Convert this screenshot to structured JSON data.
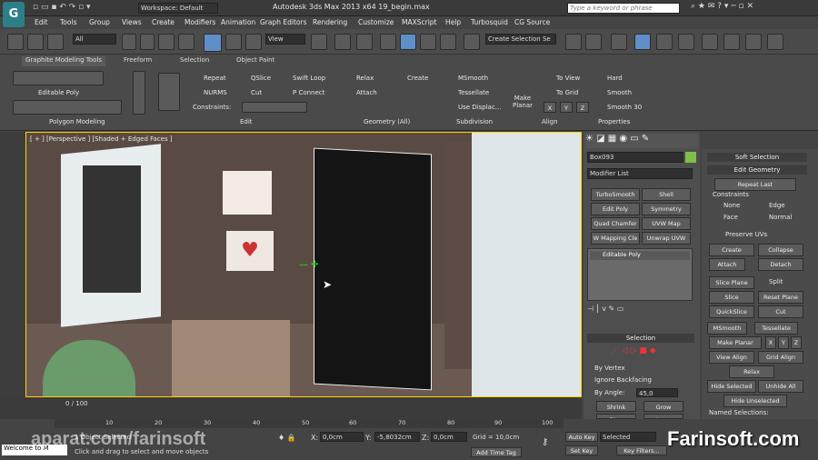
{
  "window": {
    "title": "Autodesk 3ds Max  2013 x64     19_begin.max",
    "workspace": "Workspace: Default",
    "search_placeholder": "Type a keyword or phrase"
  },
  "menu": [
    "Edit",
    "Tools",
    "Group",
    "Views",
    "Create",
    "Modifiers",
    "Animation",
    "Graph Editors",
    "Rendering",
    "Customize",
    "MAXScript",
    "Help",
    "Turbosquid",
    "CG Source"
  ],
  "toolbar": {
    "filter": "All",
    "view": "View",
    "selection_set": "Create Selection Se"
  },
  "ribbon": {
    "tabs": [
      "Graphite Modeling Tools",
      "Freeform",
      "Selection",
      "Object Paint"
    ],
    "editable_poly": "Editable Poly",
    "polygon_modeling": "Polygon Modeling",
    "repeat": "Repeat",
    "qslice": "QSlice",
    "swift_loop": "Swift Loop",
    "nurms": "NURMS",
    "cut": "Cut",
    "p_connect": "P Connect",
    "constraints": "Constraints:",
    "edit": "Edit",
    "relax": "Relax",
    "create": "Create",
    "attach": "Attach",
    "geometry_all": "Geometry (All)",
    "msmooth": "MSmooth",
    "tessellate": "Tessellate",
    "use_displac": "Use Displac...",
    "subdivision": "Subdivision",
    "make_planar": "Make Planar",
    "to_view": "To View",
    "to_grid": "To Grid",
    "x": "X",
    "y": "Y",
    "z": "Z",
    "align": "Align",
    "hard": "Hard",
    "smooth": "Smooth",
    "smooth30": "Smooth 30",
    "properties": "Properties"
  },
  "viewport": {
    "label": "[ + ] [Perspective ] [Shaded + Edged Faces ]"
  },
  "command_panel": {
    "object_name": "Box093",
    "modifier_list": "Modifier List",
    "buttons": [
      "TurboSmooth",
      "Shell",
      "Edit Poly",
      "Symmetry",
      "Quad Chamfer",
      "UVW Map",
      "W Mapping Cle",
      "Unwrap UVW"
    ],
    "stack_item": "Editable Poly",
    "selection": "Selection",
    "by_vertex": "By Vertex",
    "ignore_backfacing": "Ignore Backfacing",
    "by_angle": "By Angle:",
    "angle_value": "45,0",
    "shrink": "Shrink",
    "grow": "Grow",
    "ring": "Ring",
    "loop": "Loop"
  },
  "graphite_panel": {
    "soft_selection": "Soft Selection",
    "edit_geometry": "Edit Geometry",
    "repeat_last": "Repeat Last",
    "constraints": "Constraints",
    "none": "None",
    "edge": "Edge",
    "face": "Face",
    "normal": "Normal",
    "preserve_uvs": "Preserve UVs",
    "create": "Create",
    "collapse": "Collapse",
    "attach": "Attach",
    "detach": "Detach",
    "slice_plane": "Slice Plane",
    "split": "Split",
    "slice": "Slice",
    "reset_plane": "Reset Plane",
    "quickslice": "QuickSlice",
    "cut": "Cut",
    "msmooth": "MSmooth",
    "tessellate": "Tessellate",
    "make_planar": "Make Planar",
    "x": "X",
    "y": "Y",
    "z": "Z",
    "view_align": "View Align",
    "grid_align": "Grid Align",
    "relax": "Relax",
    "hide_selected": "Hide Selected",
    "unhide_all": "Unhide All",
    "hide_unselected": "Hide Unselected",
    "named_selections": "Named Selections:"
  },
  "timeline": {
    "frame": "0 / 100",
    "ticks": [
      "10",
      "20",
      "30",
      "40",
      "50",
      "60",
      "70",
      "80",
      "90",
      "100"
    ]
  },
  "status": {
    "object_selected": "1 Object Selected",
    "prompt": "Click and drag to select and move objects",
    "x": "0,0cm",
    "y": "-5,8032cm",
    "z": "0,0cm",
    "grid": "Grid = 10,0cm",
    "add_time_tag": "Add Time Tag",
    "auto_key": "Auto Key",
    "set_key": "Set Key",
    "selected": "Selected",
    "key_filters": "Key Filters...",
    "welcome": "Welcome to M"
  },
  "watermarks": {
    "left": "aparat.com/farinsoft",
    "right": "Farinsoft.com"
  }
}
